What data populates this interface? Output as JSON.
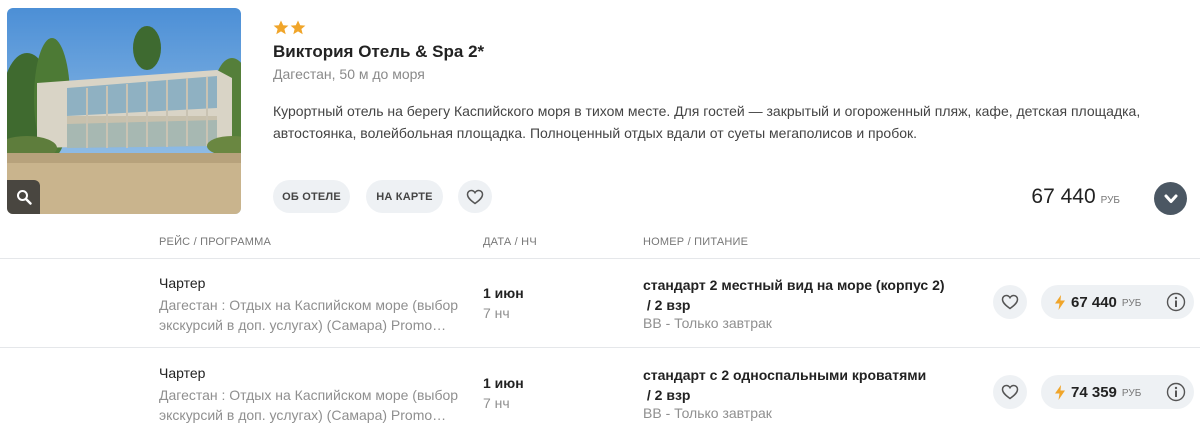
{
  "hotel": {
    "stars": 2,
    "star_color": "#f0a52a",
    "name": "Виктория Отель & Spa 2*",
    "location": "Дагестан, 50 м до моря",
    "description": "Курортный отель на берегу Каспийского моря в тихом месте. Для гостей — закрытый и огороженный пляж, кафе, детская площадка, автостоянка, волейбольная площадка. Полноценный отдых вдали от суеты мегаполисов и пробок.",
    "about_label": "ОБ ОТЕЛЕ",
    "map_label": "НА КАРТЕ",
    "price": "67 440",
    "currency": "РУБ",
    "icons": {
      "zoom": "search-icon",
      "favorite": "heart-icon",
      "expand": "chevron-down-icon"
    }
  },
  "table": {
    "headers": {
      "route": "РЕЙС / ПРОГРАММА",
      "date": "ДАТА / НЧ",
      "room": "НОМЕР / ПИТАНИЕ"
    },
    "rows": [
      {
        "type": "Чартер",
        "program": "Дагестан : Отдых на Каспийском море (выбор экскурсий в доп. услугах) (Самара) Promo…",
        "date": "1 июн",
        "nights": "7 нч",
        "room": "стандарт 2 местный вид на море (корпус 2)",
        "guests": " / 2 взр",
        "meal": "BB - Только завтрак",
        "price": "67 440",
        "currency": "РУБ"
      },
      {
        "type": "Чартер",
        "program": "Дагестан : Отдых на Каспийском море (выбор экскурсий в доп. услугах) (Самара) Promo…",
        "date": "1 июн",
        "nights": "7 нч",
        "room": "стандарт с 2 односпальными кроватями",
        "guests": " / 2 взр",
        "meal": "BB - Только завтрак",
        "price": "74 359",
        "currency": "РУБ"
      }
    ],
    "icons": {
      "favorite": "heart-icon",
      "hot_offer": "lightning-icon",
      "info": "info-icon"
    },
    "accent_color": "#f0a52a"
  }
}
